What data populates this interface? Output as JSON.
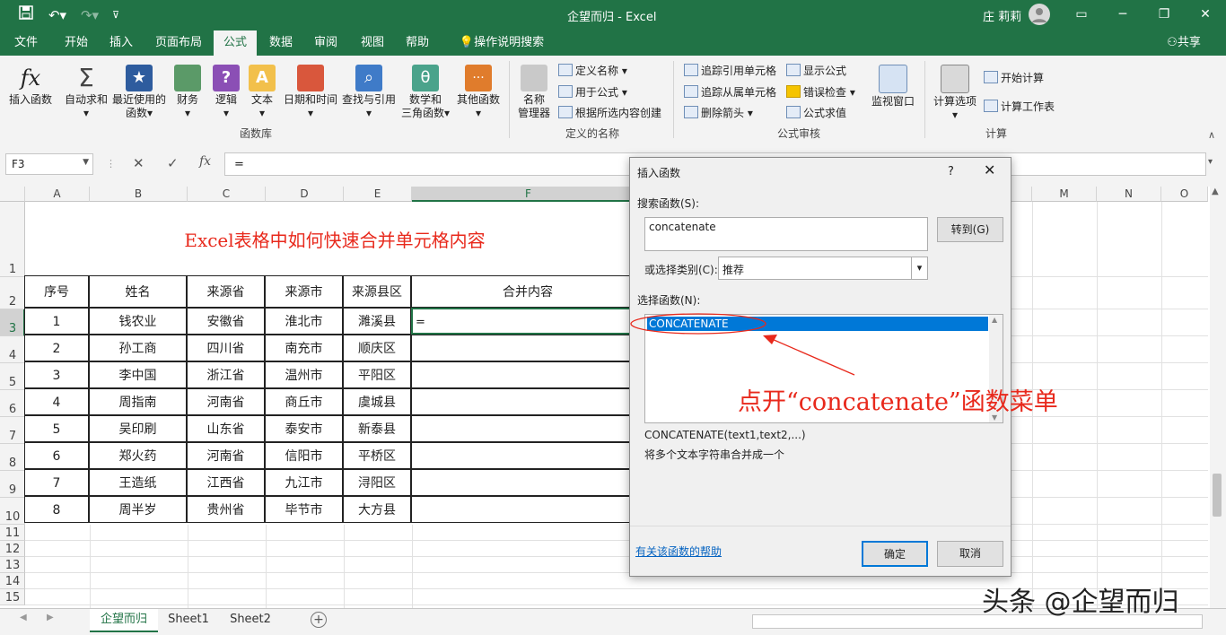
{
  "window": {
    "doc_title": "企望而归",
    "app_name": "Excel",
    "title_sep": "-",
    "user": "庄 莉莉",
    "share": "共享"
  },
  "tabs": [
    "文件",
    "开始",
    "插入",
    "页面布局",
    "公式",
    "数据",
    "审阅",
    "视图",
    "帮助",
    "操作说明搜索"
  ],
  "ribbon": {
    "insert_fn": "插入函数",
    "autosum": "自动求和",
    "recent": [
      "最近使用的",
      "函数"
    ],
    "finance": "财务",
    "logic": "逻辑",
    "text": "文本",
    "datetime": "日期和时间",
    "lookup": "查找与引用",
    "math": [
      "数学和",
      "三角函数"
    ],
    "other": "其他函数",
    "group_lib": "函数库",
    "name_mgr": [
      "名称",
      "管理器"
    ],
    "define_name": "定义名称",
    "use_in_formula": "用于公式",
    "create_from_sel": "根据所选内容创建",
    "group_names": "定义的名称",
    "trace_prec": "追踪引用单元格",
    "trace_dep": "追踪从属单元格",
    "remove_arrows": "删除箭头",
    "show_formulas": "显示公式",
    "error_check": "错误检查",
    "eval_formula": "公式求值",
    "watch": "监视窗口",
    "group_audit": "公式审核",
    "calc_options": "计算选项",
    "calc_now": "开始计算",
    "calc_sheet": "计算工作表",
    "group_calc": "计算"
  },
  "formula_bar": {
    "name_box": "F3",
    "formula": "=",
    "fx": "fx"
  },
  "columns": [
    "A",
    "B",
    "C",
    "D",
    "E",
    "F",
    "M",
    "N",
    "O"
  ],
  "rows": [
    "1",
    "2",
    "3",
    "4",
    "5",
    "6",
    "7",
    "8",
    "9",
    "10",
    "11",
    "12",
    "13",
    "14",
    "15"
  ],
  "sheet": {
    "title": "Excel表格中如何快速合并单元格内容",
    "headers": [
      "序号",
      "姓名",
      "来源省",
      "来源市",
      "来源县区",
      "合并内容"
    ],
    "data": [
      [
        "1",
        "钱农业",
        "安徽省",
        "淮北市",
        "濉溪县",
        "="
      ],
      [
        "2",
        "孙工商",
        "四川省",
        "南充市",
        "顺庆区",
        ""
      ],
      [
        "3",
        "李中国",
        "浙江省",
        "温州市",
        "平阳区",
        ""
      ],
      [
        "4",
        "周指南",
        "河南省",
        "商丘市",
        "虞城县",
        ""
      ],
      [
        "5",
        "吴印刷",
        "山东省",
        "泰安市",
        "新泰县",
        ""
      ],
      [
        "6",
        "郑火药",
        "河南省",
        "信阳市",
        "平桥区",
        ""
      ],
      [
        "7",
        "王造纸",
        "江西省",
        "九江市",
        "浔阳区",
        ""
      ],
      [
        "8",
        "周半岁",
        "贵州省",
        "毕节市",
        "大方县",
        ""
      ]
    ]
  },
  "sheet_tabs": [
    "企望而归",
    "Sheet1",
    "Sheet2"
  ],
  "dialog": {
    "title": "插入函数",
    "help_q": "?",
    "search_label": "搜索函数(S):",
    "search_value": "concatenate",
    "go_button": "转到(G)",
    "category_label": "或选择类别(C):",
    "category_value": "推荐",
    "select_label": "选择函数(N):",
    "functions": [
      "CONCATENATE"
    ],
    "signature": "CONCATENATE(text1,text2,...)",
    "description": "将多个文本字符串合并成一个",
    "help_link": "有关该函数的帮助",
    "ok": "确定",
    "cancel": "取消"
  },
  "annotation": "点开“concatenate”函数菜单",
  "watermark": "头条 @企望而归",
  "colors": {
    "excel_green": "#217346",
    "selection_blue": "#0078d7",
    "annotation_red": "#e8291c"
  }
}
